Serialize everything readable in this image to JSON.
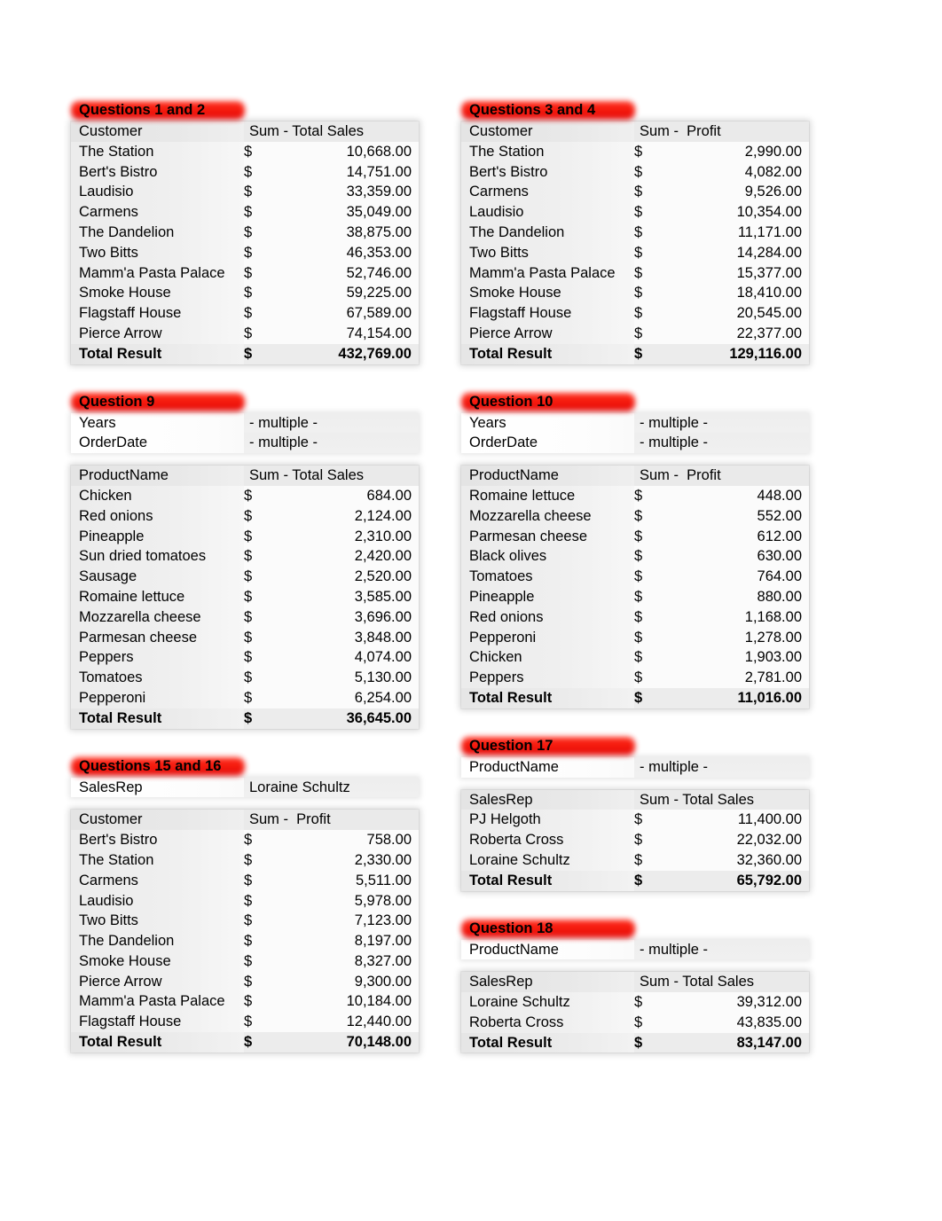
{
  "page": {
    "background": "#ffffff",
    "highlight_color": "#f60d00",
    "currency_symbol": "$"
  },
  "left_column": [
    {
      "title": "Questions 1 and 2",
      "title_width": 196,
      "filters": [],
      "table": {
        "header": {
          "label": "Customer",
          "value": "Sum - Total Sales"
        },
        "rows": [
          {
            "label": "The Station",
            "value": "10,668.00"
          },
          {
            "label": "Bert's Bistro",
            "value": "14,751.00"
          },
          {
            "label": "Laudisio",
            "value": "33,359.00"
          },
          {
            "label": "Carmens",
            "value": "35,049.00"
          },
          {
            "label": "The Dandelion",
            "value": "38,875.00"
          },
          {
            "label": "Two Bitts",
            "value": "46,353.00"
          },
          {
            "label": "Mamm'a Pasta Palace",
            "value": "52,746.00"
          },
          {
            "label": "Smoke House",
            "value": "59,225.00"
          },
          {
            "label": "Flagstaff House",
            "value": "67,589.00"
          },
          {
            "label": "Pierce Arrow",
            "value": "74,154.00"
          }
        ],
        "total": {
          "label": "Total Result",
          "value": "432,769.00"
        }
      }
    },
    {
      "title": "Question 9",
      "title_width": 196,
      "filters": [
        {
          "label": "Years",
          "value": "- multiple -"
        },
        {
          "label": "OrderDate",
          "value": "- multiple -"
        }
      ],
      "table": {
        "header": {
          "label": "ProductName",
          "value": "Sum - Total Sales"
        },
        "rows": [
          {
            "label": "Chicken",
            "value": "684.00"
          },
          {
            "label": "Red onions",
            "value": "2,124.00"
          },
          {
            "label": "Pineapple",
            "value": "2,310.00"
          },
          {
            "label": "Sun dried tomatoes",
            "value": "2,420.00"
          },
          {
            "label": "Sausage",
            "value": "2,520.00"
          },
          {
            "label": "Romaine lettuce",
            "value": "3,585.00"
          },
          {
            "label": "Mozzarella cheese",
            "value": "3,696.00"
          },
          {
            "label": "Parmesan cheese",
            "value": "3,848.00"
          },
          {
            "label": "Peppers",
            "value": "4,074.00"
          },
          {
            "label": "Tomatoes",
            "value": "5,130.00"
          },
          {
            "label": "Pepperoni",
            "value": "6,254.00"
          }
        ],
        "total": {
          "label": "Total Result",
          "value": "36,645.00"
        }
      }
    },
    {
      "title": "Questions 15 and 16",
      "title_width": 196,
      "filters": [
        {
          "label": "SalesRep",
          "value": "Loraine Schultz"
        }
      ],
      "table": {
        "header": {
          "label": "Customer",
          "value": "Sum -  Profit"
        },
        "rows": [
          {
            "label": "Bert's Bistro",
            "value": "758.00"
          },
          {
            "label": "The Station",
            "value": "2,330.00"
          },
          {
            "label": "Carmens",
            "value": "5,511.00"
          },
          {
            "label": "Laudisio",
            "value": "5,978.00"
          },
          {
            "label": "Two Bitts",
            "value": "7,123.00"
          },
          {
            "label": "The Dandelion",
            "value": "8,197.00"
          },
          {
            "label": "Smoke House",
            "value": "8,327.00"
          },
          {
            "label": "Pierce Arrow",
            "value": "9,300.00"
          },
          {
            "label": "Mamm'a Pasta Palace",
            "value": "10,184.00"
          },
          {
            "label": "Flagstaff House",
            "value": "12,440.00"
          }
        ],
        "total": {
          "label": "Total Result",
          "value": "70,148.00"
        }
      }
    }
  ],
  "right_column": [
    {
      "title": "Questions 3 and 4",
      "title_width": 196,
      "filters": [],
      "table": {
        "header": {
          "label": "Customer",
          "value": "Sum -  Profit"
        },
        "rows": [
          {
            "label": "The Station",
            "value": "2,990.00"
          },
          {
            "label": "Bert's Bistro",
            "value": "4,082.00"
          },
          {
            "label": "Carmens",
            "value": "9,526.00"
          },
          {
            "label": "Laudisio",
            "value": "10,354.00"
          },
          {
            "label": "The Dandelion",
            "value": "11,171.00"
          },
          {
            "label": "Two Bitts",
            "value": "14,284.00"
          },
          {
            "label": "Mamm'a Pasta Palace",
            "value": "15,377.00"
          },
          {
            "label": "Smoke House",
            "value": "18,410.00"
          },
          {
            "label": "Flagstaff House",
            "value": "20,545.00"
          },
          {
            "label": "Pierce Arrow",
            "value": "22,377.00"
          }
        ],
        "total": {
          "label": "Total Result",
          "value": "129,116.00"
        }
      }
    },
    {
      "title": "Question 10",
      "title_width": 196,
      "filters": [
        {
          "label": "Years",
          "value": "- multiple -"
        },
        {
          "label": "OrderDate",
          "value": "- multiple -"
        }
      ],
      "table": {
        "header": {
          "label": "ProductName",
          "value": "Sum -  Profit"
        },
        "rows": [
          {
            "label": "Romaine lettuce",
            "value": "448.00"
          },
          {
            "label": "Mozzarella cheese",
            "value": "552.00"
          },
          {
            "label": "Parmesan cheese",
            "value": "612.00"
          },
          {
            "label": "Black olives",
            "value": "630.00"
          },
          {
            "label": "Tomatoes",
            "value": "764.00"
          },
          {
            "label": "Pineapple",
            "value": "880.00"
          },
          {
            "label": "Red onions",
            "value": "1,168.00"
          },
          {
            "label": "Pepperoni",
            "value": "1,278.00"
          },
          {
            "label": "Chicken",
            "value": "1,903.00"
          },
          {
            "label": "Peppers",
            "value": "2,781.00"
          }
        ],
        "total": {
          "label": "Total Result",
          "value": "11,016.00"
        }
      }
    },
    {
      "title": "Question 17",
      "title_width": 196,
      "filters": [
        {
          "label": "ProductName",
          "value": "- multiple -"
        }
      ],
      "table": {
        "header": {
          "label": "SalesRep",
          "value": "Sum - Total Sales"
        },
        "rows": [
          {
            "label": "PJ Helgoth",
            "value": "11,400.00"
          },
          {
            "label": "Roberta Cross",
            "value": "22,032.00"
          },
          {
            "label": "Loraine Schultz",
            "value": "32,360.00"
          }
        ],
        "total": {
          "label": "Total Result",
          "value": "65,792.00"
        }
      }
    },
    {
      "title": "Question 18",
      "title_width": 196,
      "filters": [
        {
          "label": "ProductName",
          "value": "- multiple -"
        }
      ],
      "table": {
        "header": {
          "label": "SalesRep",
          "value": "Sum - Total Sales"
        },
        "rows": [
          {
            "label": "Loraine Schultz",
            "value": "39,312.00"
          },
          {
            "label": "Roberta Cross",
            "value": "43,835.00"
          }
        ],
        "total": {
          "label": "Total Result",
          "value": "83,147.00"
        }
      }
    }
  ]
}
